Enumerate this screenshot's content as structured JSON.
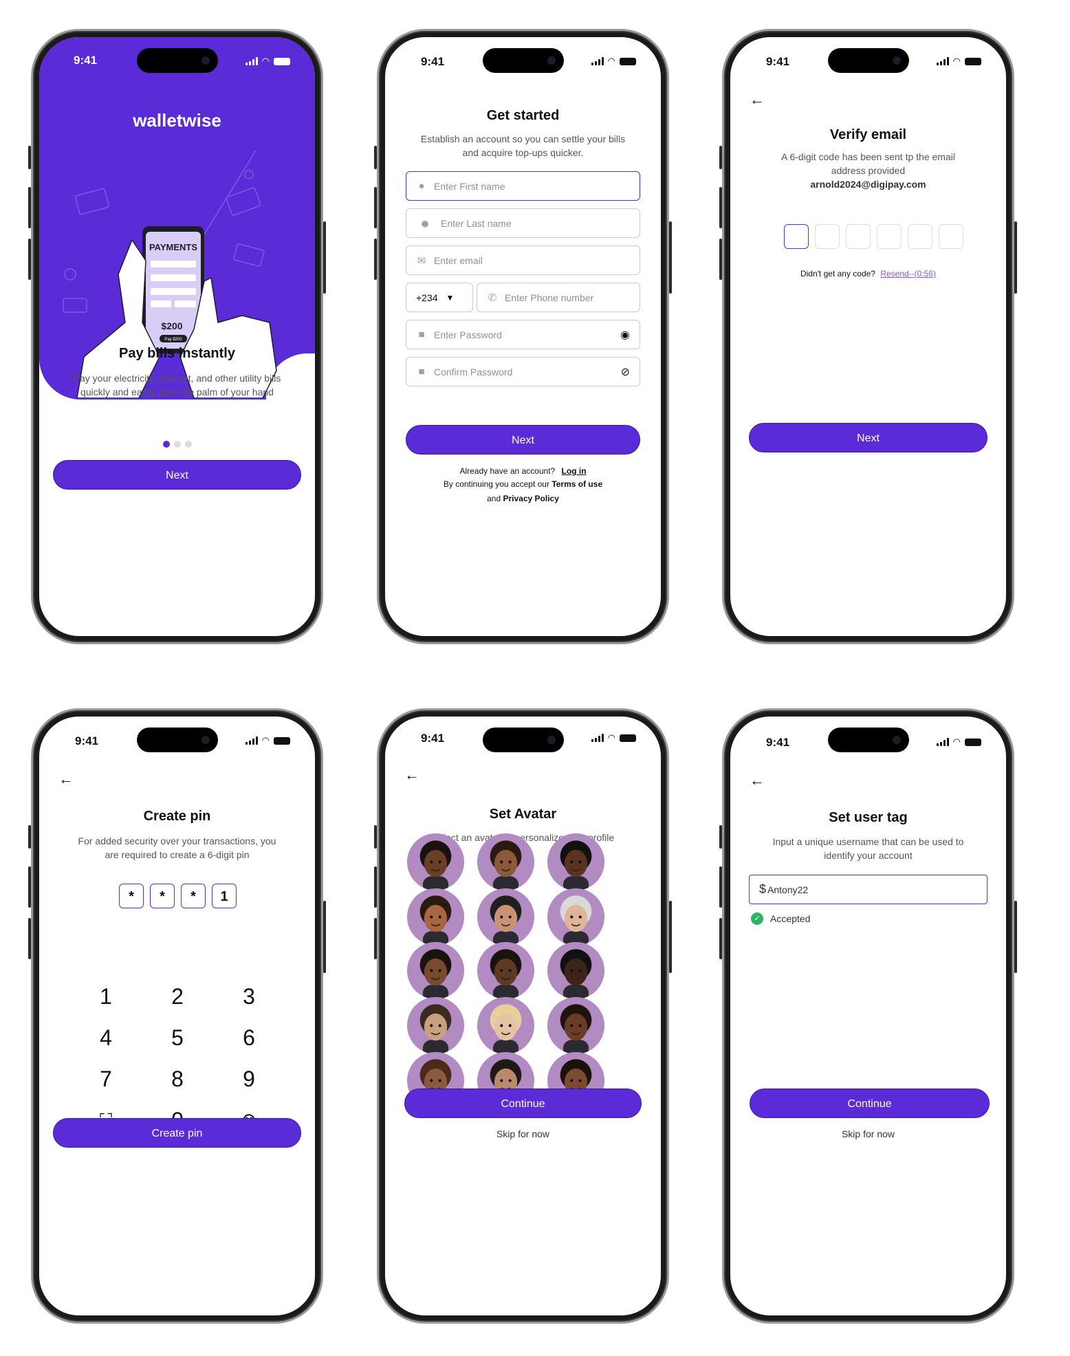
{
  "status": {
    "time": "9:41"
  },
  "colors": {
    "brand": "#5a2bd6",
    "success": "#2db55d"
  },
  "onboarding": {
    "brand_name": "walletwise",
    "illus": {
      "heading": "PAYMENTS",
      "amount": "$200",
      "pay_button": "Pay $200"
    },
    "title": "Pay bills instantly",
    "subtitle": "Pay your electricity, internet, and other utility bills quickly and easily from the palm of your hand",
    "next": "Next"
  },
  "signup": {
    "title": "Get started",
    "subtitle": "Establish an account so you can settle your bills and acquire top-ups quicker.",
    "first_name_placeholder": "Enter First name",
    "last_name_placeholder": "Enter Last name",
    "email_placeholder": "Enter email",
    "country_code": "+234",
    "phone_placeholder": "Enter Phone number",
    "password_placeholder": "Enter Password",
    "confirm_password_placeholder": "Confirm Password",
    "next": "Next",
    "have_account": "Already have an account?",
    "login": "Log in",
    "terms_prefix": "By continuing you accept our",
    "terms": "Terms of use",
    "and": "and",
    "privacy": "Privacy Policy"
  },
  "verify": {
    "title": "Verify email",
    "subtitle": "A 6-digit code has been sent tp the email address provided",
    "email": "arnold2024@digipay.com",
    "no_code": "Didn't get any code?",
    "resend": "Resend--(0:56)",
    "next": "Next"
  },
  "pin": {
    "title": "Create pin",
    "subtitle": "For added security over your transactions, you are required to create a 6-digit pin",
    "digits": [
      "*",
      "*",
      "*",
      "1"
    ],
    "keys": [
      "1",
      "2",
      "3",
      "4",
      "5",
      "6",
      "7",
      "8",
      "9",
      "0"
    ],
    "button": "Create pin"
  },
  "avatar": {
    "title": "Set Avatar",
    "subtitle": "Select an avatar to personalize your profile",
    "continue": "Continue",
    "skip": "Skip for now"
  },
  "usertag": {
    "title": "Set user tag",
    "subtitle": "Input a unique username that can be used to identify your account",
    "prefix": "$",
    "value": "Antony22",
    "status": "Accepted",
    "continue": "Continue",
    "skip": "Skip for now"
  }
}
